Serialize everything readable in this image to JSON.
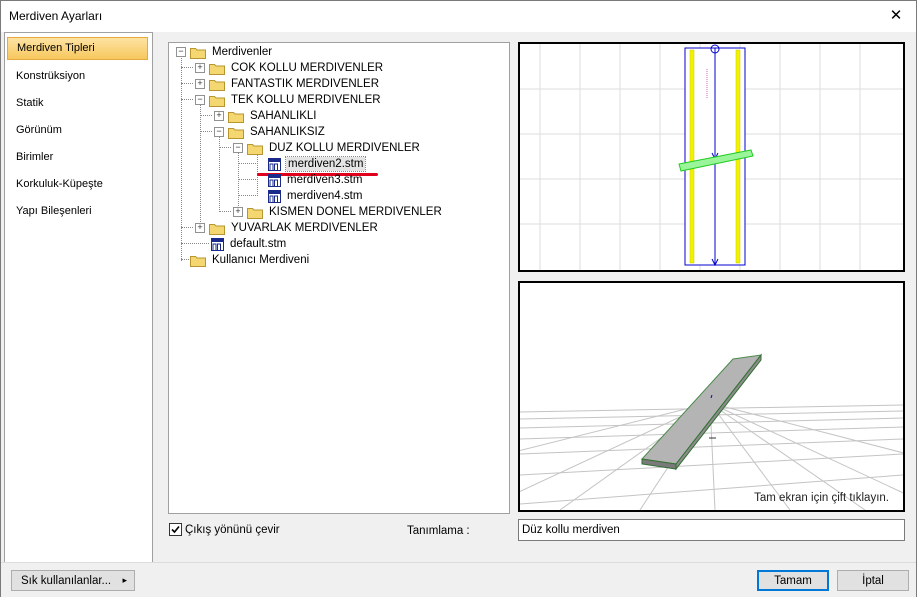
{
  "window": {
    "title": "Merdiven Ayarları",
    "close_symbol": "✕"
  },
  "sidebar": {
    "items": [
      {
        "label": "Merdiven Tipleri",
        "active": true
      },
      {
        "label": "Konstrüksiyon"
      },
      {
        "label": "Statik"
      },
      {
        "label": "Görünüm"
      },
      {
        "label": "Birimler"
      },
      {
        "label": "Korkuluk-Küpeşte"
      },
      {
        "label": "Yapı Bileşenleri"
      }
    ]
  },
  "tree": {
    "root": "Merdivenler",
    "cok_kollu": "COK KOLLU MERDIVENLER",
    "fantastik": "FANTASTIK MERDIVENLER",
    "tek_kollu": "TEK KOLLU MERDIVENLER",
    "sahanlikli": "SAHANLIKLI",
    "sahanliksiz": "SAHANLIKSIZ",
    "duz_kollu": "DUZ KOLLU MERDIVENLER",
    "file1": "merdiven2.stm",
    "file2": "merdiven3.stm",
    "file3": "merdiven4.stm",
    "kismen_donel": "KISMEN DONEL MERDIVENLER",
    "yuvarlak": "YUVARLAK MERDIVENLER",
    "default_file": "default.stm",
    "kullanici": "Kullanıcı Merdiveni",
    "expanded_symbol": "−",
    "collapsed_symbol": "+"
  },
  "preview": {
    "hint": "Tam ekran için çift tıklayın."
  },
  "options": {
    "reverse_exit_label": "Çıkış yönünü çevir",
    "reverse_exit_checked": true,
    "description_label": "Tanımlama :",
    "description_value": "Düz kollu merdiven"
  },
  "buttons": {
    "frequent": "Sık kullanılanlar...",
    "frequent_arrow": "▸",
    "ok": "Tamam",
    "cancel": "İptal"
  },
  "colors": {
    "accent_orange": "#f7c75d",
    "highlight_red": "#e0001b",
    "stair_blue": "#0000cc",
    "stair_yellow": "#f2f200",
    "cut_green": "#22cc22",
    "slab_gray": "#b4b4b4"
  },
  "icons": {
    "folder": "folder-icon",
    "stair_file": "stair-file-icon",
    "close": "close-icon",
    "check": "checkmark-icon"
  }
}
